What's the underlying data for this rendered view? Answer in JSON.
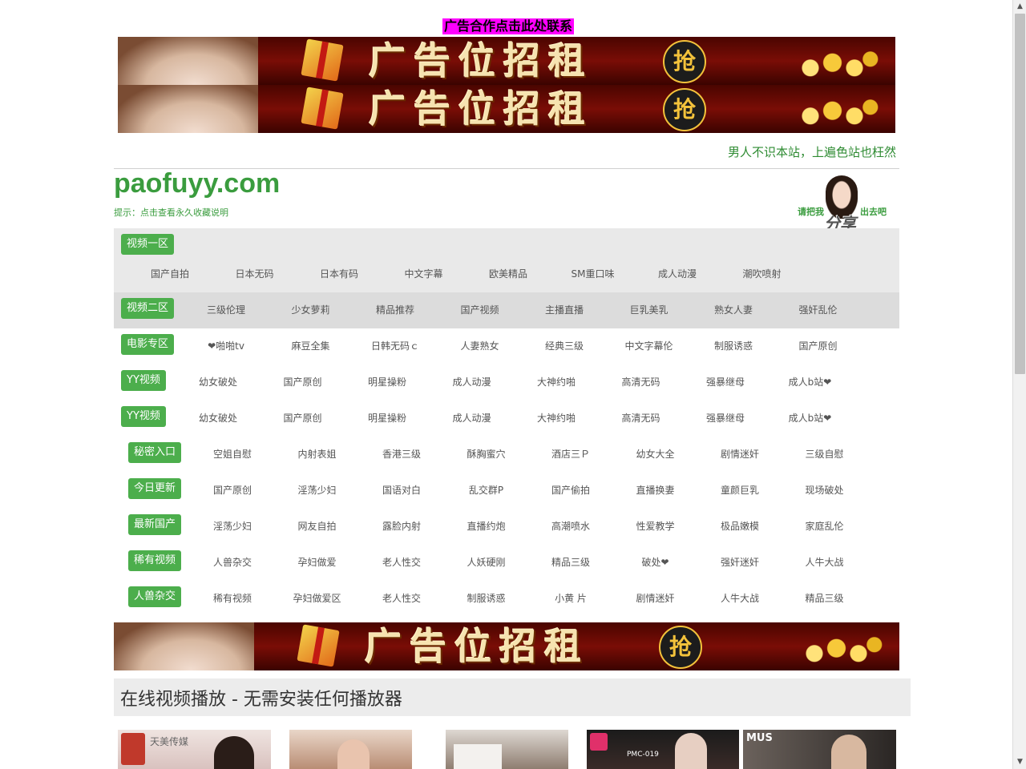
{
  "ad": {
    "contact": "广告合作点击此处联系",
    "banner_text": "广告位招租",
    "banner_badge": "抢"
  },
  "header": {
    "slogan": "男人不识本站，上遍色站也枉然",
    "site_name": "paofuyy.com",
    "tip": "提示：点击查看永久收藏说明",
    "share_left": "请把我",
    "share_right": "出去吧",
    "share_big": "分享"
  },
  "nav": {
    "rows": [
      {
        "label": "视频一区",
        "links": [
          "国产自拍",
          "日本无码",
          "日本有码",
          "中文字幕",
          "欧美精品",
          "SM重口味",
          "成人动漫",
          "潮吹喷射"
        ]
      },
      {
        "label": "视频二区",
        "links": [
          "三级伦理",
          "少女萝莉",
          "精品推荐",
          "国产视频",
          "主播直播",
          "巨乳美乳",
          "熟女人妻",
          "强奸乱伦"
        ]
      },
      {
        "label": "电影专区",
        "links": [
          "❤啪啪tv",
          "麻豆全集",
          "日韩无码ｃ",
          "人妻熟女",
          "经典三级",
          "中文字幕伦",
          "制服诱惑",
          "国产原创"
        ]
      },
      {
        "label": "YY视频",
        "links": [
          "幼女破处",
          "国产原创",
          "明星操粉",
          "成人动漫",
          "大神约啪",
          "高清无码",
          "强暴继母",
          "成人b站❤"
        ]
      },
      {
        "label": "YY视频",
        "links": [
          "幼女破处",
          "国产原创",
          "明星操粉",
          "成人动漫",
          "大神约啪",
          "高清无码",
          "强暴继母",
          "成人b站❤"
        ]
      },
      {
        "label": "秘密入口",
        "links": [
          "空姐自慰",
          "内射表姐",
          "香港三级",
          "酥胸蜜穴",
          "酒店三Ｐ",
          "幼女大全",
          "剧情迷奸",
          "三级自慰"
        ]
      },
      {
        "label": "今日更新",
        "links": [
          "国产原创",
          "淫荡少妇",
          "国语对白",
          "乱交群P",
          "国产偷拍",
          "直播换妻",
          "童颜巨乳",
          "现场破处"
        ]
      },
      {
        "label": "最新国产",
        "links": [
          "淫荡少妇",
          "网友自拍",
          "露脸内射",
          "直播约炮",
          "高潮喷水",
          "性爱教学",
          "极品嫩模",
          "家庭乱伦"
        ]
      },
      {
        "label": "稀有视频",
        "links": [
          "人兽杂交",
          "孕妇做爱",
          "老人性交",
          "人妖硬刚",
          "精品三级",
          "破处❤",
          "强奸迷奸",
          "人牛大战"
        ]
      },
      {
        "label": "人兽杂交",
        "links": [
          "稀有视频",
          "孕妇做爱区",
          "老人性交",
          "制服诱惑",
          "小黄 片",
          "剧情迷奸",
          "人牛大战",
          "精品三级"
        ]
      }
    ]
  },
  "section": {
    "title": "在线视频播放 - 无需安装任何播放器"
  },
  "thumbnails": [
    {
      "caption": "天美传媒"
    },
    {
      "caption": ""
    },
    {
      "caption": ""
    },
    {
      "caption": "PMC-019"
    },
    {
      "caption": "MUS"
    }
  ],
  "colors": {
    "accent_green": "#4cae4c",
    "text_green": "#3a9c3e",
    "ad_magenta": "#ff00ff",
    "banner_red": "#7a0d06"
  }
}
